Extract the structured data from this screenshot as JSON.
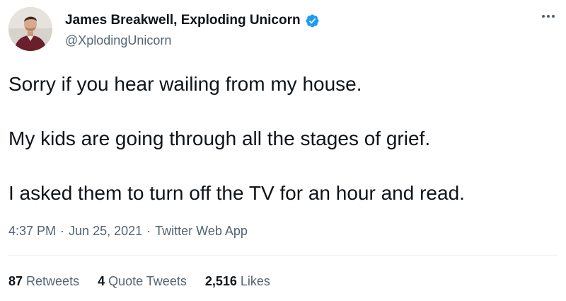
{
  "author": {
    "display_name": "James Breakwell, Exploding Unicorn",
    "handle": "@XplodingUnicorn",
    "verified": true
  },
  "tweet": {
    "lines": [
      "Sorry if you hear wailing from my house.",
      "My kids are going through all the stages of grief.",
      "I asked them to turn off the TV for an hour and read."
    ],
    "time": "4:37 PM",
    "date": "Jun 25, 2021",
    "separator": "·",
    "source": "Twitter Web App"
  },
  "stats": {
    "retweets": {
      "count": "87",
      "label": "Retweets"
    },
    "quote_tweets": {
      "count": "4",
      "label": "Quote Tweets"
    },
    "likes": {
      "count": "2,516",
      "label": "Likes"
    }
  },
  "icons": {
    "verified": "verified-badge-icon",
    "more": "more-options-icon"
  },
  "colors": {
    "text_primary": "#0f1419",
    "text_secondary": "#536471",
    "verified_blue": "#1d9bf0",
    "divider": "#eff3f4"
  }
}
